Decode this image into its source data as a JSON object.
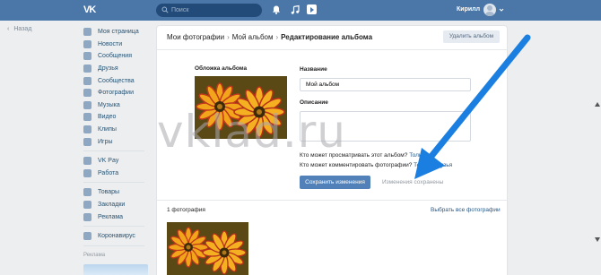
{
  "topbar": {
    "logo_icon": "vk-logo-icon",
    "search_placeholder": "Поиск",
    "icons": [
      "bell-icon",
      "music-icon",
      "video-icon"
    ],
    "username": "Кирилл",
    "brand_color": "#4a76a8"
  },
  "back_label": "Назад",
  "sidebar": {
    "items": [
      {
        "label": "Моя страница",
        "icon": "home-icon"
      },
      {
        "label": "Новости",
        "icon": "news-icon"
      },
      {
        "label": "Сообщения",
        "icon": "messages-icon"
      },
      {
        "label": "Друзья",
        "icon": "friends-icon"
      },
      {
        "label": "Сообщества",
        "icon": "groups-icon"
      },
      {
        "label": "Фотографии",
        "icon": "photos-icon"
      },
      {
        "label": "Музыка",
        "icon": "music-icon"
      },
      {
        "label": "Видео",
        "icon": "video-icon"
      },
      {
        "label": "Клипы",
        "icon": "clips-icon"
      },
      {
        "label": "Игры",
        "icon": "games-icon"
      }
    ],
    "items2": [
      {
        "label": "VK Pay",
        "icon": "vkpay-icon"
      },
      {
        "label": "Работа",
        "icon": "work-icon"
      }
    ],
    "items3": [
      {
        "label": "Товары",
        "icon": "goods-icon"
      },
      {
        "label": "Закладки",
        "icon": "bookmarks-icon"
      },
      {
        "label": "Реклама",
        "icon": "ads-icon"
      }
    ],
    "items4": [
      {
        "label": "Коронавирус",
        "icon": "virus-icon"
      }
    ],
    "ads_label": "Реклама"
  },
  "breadcrumb": {
    "items": [
      "Мои фотографии",
      "Мой альбом",
      "Редактирование альбома"
    ]
  },
  "delete_button": "Удалить альбом",
  "form": {
    "cover_label": "Обложка альбома",
    "name_label": "Название",
    "name_value": "Мой альбом",
    "desc_label": "Описание",
    "privacy_view_q": "Кто может просматривать этот альбом?",
    "privacy_view_v": "Только я",
    "privacy_comment_q": "Кто может комментировать фотографии?",
    "privacy_comment_v": "Только друзья",
    "save_button": "Сохранить изменения",
    "saved_note": "Изменения сохранены"
  },
  "photos": {
    "count": "1 фотография",
    "select_all": "Выбрать все фотографии"
  },
  "watermark": "vklad.ru",
  "accent_arrow_color": "#1a7fe0"
}
